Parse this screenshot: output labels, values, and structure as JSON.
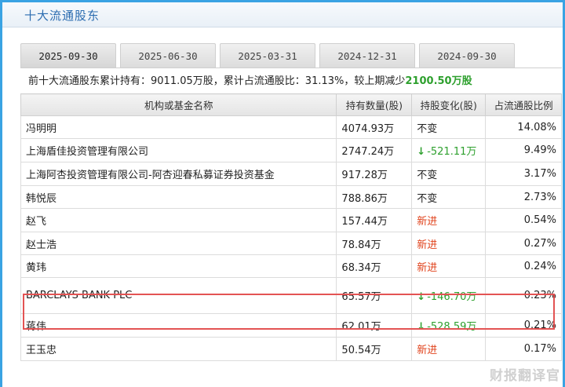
{
  "section_title": "十大流通股东",
  "tabs": [
    "2025-09-30",
    "2025-06-30",
    "2025-03-31",
    "2024-12-31",
    "2024-09-30"
  ],
  "summary": {
    "prefix": "前十大流通股东累计持有：",
    "held": "9011.05万股",
    "mid": "，累计占流通股比：",
    "ratio": "31.13%",
    "suffix": "，较上期减少",
    "change": "2100.50万股"
  },
  "table": {
    "headers": [
      "机构或基金名称",
      "持有数量(股)",
      "持股变化(股)",
      "占流通股比例"
    ],
    "rows": [
      {
        "name": "冯明明",
        "qty": "4074.93万",
        "change": "不变",
        "change_type": "plain",
        "pct": "14.08%"
      },
      {
        "name": "上海盾佳投资管理有限公司",
        "qty": "2747.24万",
        "change": "-521.11万",
        "change_type": "down",
        "pct": "9.49%"
      },
      {
        "name": "上海阿杏投资管理有限公司-阿杏迎春私募证券投资基金",
        "qty": "917.28万",
        "change": "不变",
        "change_type": "plain",
        "pct": "3.17%"
      },
      {
        "name": "韩悦辰",
        "qty": "788.86万",
        "change": "不变",
        "change_type": "plain",
        "pct": "2.73%"
      },
      {
        "name": "赵飞",
        "qty": "157.44万",
        "change": "新进",
        "change_type": "new",
        "pct": "0.54%"
      },
      {
        "name": "赵士浩",
        "qty": "78.84万",
        "change": "新进",
        "change_type": "new",
        "pct": "0.27%"
      },
      {
        "name": "黄玮",
        "qty": "68.34万",
        "change": "新进",
        "change_type": "new",
        "pct": "0.24%"
      },
      {
        "name": "BARCLAYS BANK PLC",
        "qty": "65.57万",
        "change": "-146.70万",
        "change_type": "down",
        "pct": "0.23%"
      },
      {
        "name": "蒋伟",
        "qty": "62.01万",
        "change": "-528.59万",
        "change_type": "down",
        "pct": "0.21%"
      },
      {
        "name": "王玉忠",
        "qty": "50.54万",
        "change": "新进",
        "change_type": "new",
        "pct": "0.17%"
      }
    ]
  },
  "colors": {
    "accent": "#3aa3e3",
    "title": "#2b6cb0",
    "down": "#2ea02e",
    "new": "#e0421b",
    "highlight": "#e35353"
  },
  "watermark": "财报翻译官"
}
